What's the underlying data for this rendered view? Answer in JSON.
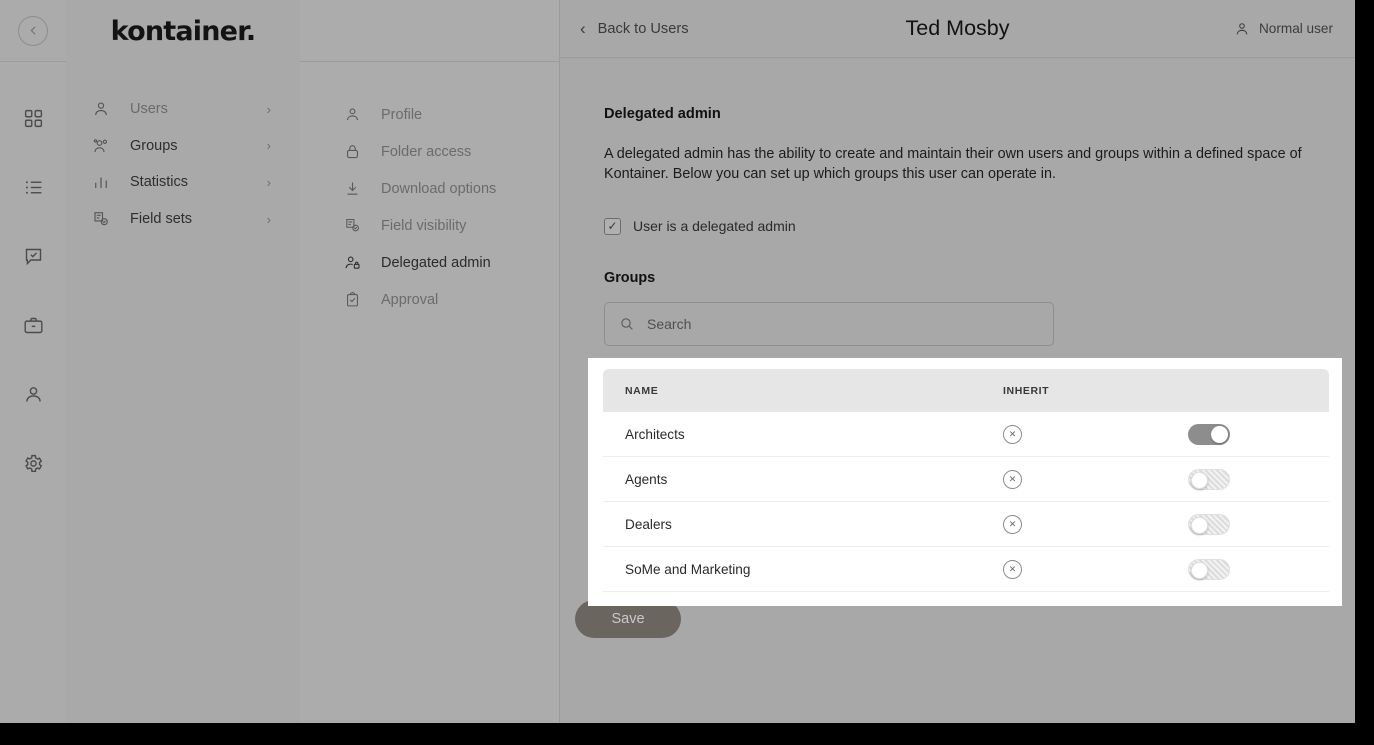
{
  "rail": {
    "collapse_label": "collapse-sidebar",
    "icons": [
      {
        "name": "grid-icon"
      },
      {
        "name": "list-icon"
      },
      {
        "name": "chat-check-icon"
      },
      {
        "name": "briefcase-icon"
      },
      {
        "name": "person-icon"
      },
      {
        "name": "gear-icon"
      }
    ]
  },
  "brand": {
    "logo": "kontainer."
  },
  "nav": {
    "items": [
      {
        "label": "Users",
        "icon": "person-icon",
        "chevron": "›"
      },
      {
        "label": "Groups",
        "icon": "group-icon",
        "chevron": "›"
      },
      {
        "label": "Statistics",
        "icon": "bar-chart-icon",
        "chevron": "›"
      },
      {
        "label": "Field sets",
        "icon": "form-check-icon",
        "chevron": "›"
      }
    ]
  },
  "submenu": {
    "items": [
      {
        "label": "Profile",
        "icon": "person-icon",
        "active": false
      },
      {
        "label": "Folder access",
        "icon": "lock-icon",
        "active": false
      },
      {
        "label": "Download options",
        "icon": "download-icon",
        "active": false
      },
      {
        "label": "Field visibility",
        "icon": "document-check-icon",
        "active": false
      },
      {
        "label": "Delegated admin",
        "icon": "person-lock-icon",
        "active": true
      },
      {
        "label": "Approval",
        "icon": "clipboard-check-icon",
        "active": false
      }
    ]
  },
  "topbar": {
    "back_label": "Back to Users",
    "back_chevron": "‹",
    "title": "Ted Mosby",
    "user_role": "Normal user"
  },
  "main": {
    "section_title": "Delegated admin",
    "description": "A delegated admin has the ability to create and maintain their own users and groups within a defined space of Kontainer. Below you can set up which groups this user can operate in.",
    "checkbox": {
      "label": "User is a delegated admin",
      "checked": true,
      "glyph": "✓"
    },
    "groups_label": "Groups",
    "search": {
      "placeholder": "Search",
      "value": ""
    },
    "save_label": "Save"
  },
  "table": {
    "columns": [
      "NAME",
      "INHERIT",
      ""
    ],
    "rows": [
      {
        "name": "Architects",
        "inherit_icon": "circle-x-icon",
        "enabled": true
      },
      {
        "name": "Agents",
        "inherit_icon": "circle-x-icon",
        "enabled": false
      },
      {
        "name": "Dealers",
        "inherit_icon": "circle-x-icon",
        "enabled": false
      },
      {
        "name": "SoMe and Marketing",
        "inherit_icon": "circle-x-icon",
        "enabled": false
      }
    ]
  },
  "colors": {
    "page_bg": "#a8a8a8",
    "panel_bg": "#a9a9a9",
    "overlay_card": "#ffffff",
    "table_header": "#e6e6e6",
    "save_button": "#6b655f",
    "toggle_on": "#8d8d8d"
  }
}
